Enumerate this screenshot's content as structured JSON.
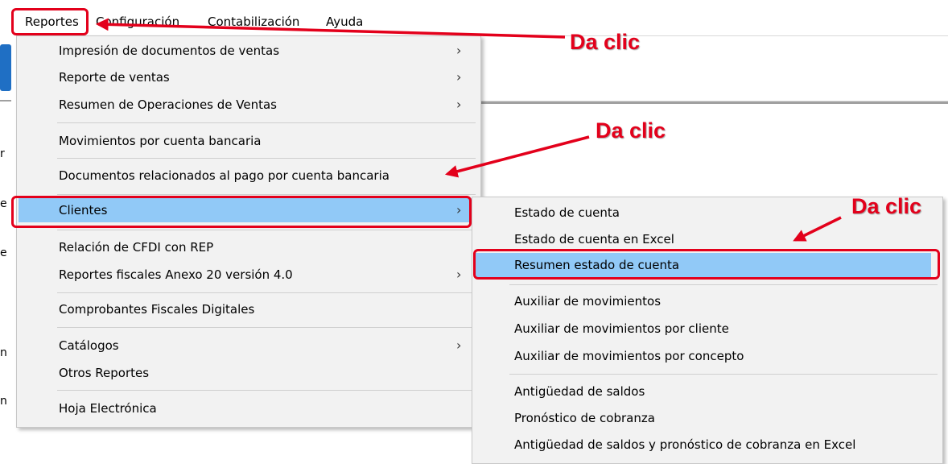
{
  "menubar": {
    "items": [
      "Reportes",
      "Configuración",
      "Contabilización",
      "Ayuda"
    ]
  },
  "left_fragments": [
    "r",
    "e",
    "e",
    "n",
    "n"
  ],
  "reportes_menu": {
    "items": [
      {
        "label": "Impresión de documentos de ventas",
        "submenu": true
      },
      {
        "label": "Reporte de ventas",
        "submenu": true
      },
      {
        "label": "Resumen de Operaciones de Ventas",
        "submenu": true
      },
      {
        "label": "Movimientos por cuenta bancaria",
        "submenu": false
      },
      {
        "label": "Documentos relacionados al pago por cuenta bancaria",
        "submenu": false
      },
      {
        "label": "Clientes",
        "submenu": true,
        "highlighted": true
      },
      {
        "label": "Relación de CFDI con REP",
        "submenu": false
      },
      {
        "label": "Reportes fiscales Anexo 20 versión 4.0",
        "submenu": true
      },
      {
        "label": "Comprobantes Fiscales Digitales",
        "submenu": false
      },
      {
        "label": "Catálogos",
        "submenu": true
      },
      {
        "label": "Otros Reportes",
        "submenu": false
      },
      {
        "label": "Hoja Electrónica",
        "submenu": false
      }
    ]
  },
  "clientes_submenu": {
    "items": [
      {
        "label": "Estado de cuenta"
      },
      {
        "label": "Estado de cuenta en Excel"
      },
      {
        "label": "Resumen estado de cuenta",
        "highlighted": true
      },
      {
        "label": "Auxiliar de movimientos"
      },
      {
        "label": "Auxiliar de movimientos por cliente"
      },
      {
        "label": "Auxiliar de movimientos por concepto"
      },
      {
        "label": "Antigüedad de saldos"
      },
      {
        "label": "Pronóstico de cobranza"
      },
      {
        "label": "Antigüedad de saldos y pronóstico de cobranza en Excel"
      }
    ]
  },
  "annotations": {
    "label_1": "Da clic",
    "label_2": "Da clic",
    "label_3": "Da clic"
  },
  "colors": {
    "highlight": "#91c9f7",
    "annotation_red": "#e3001b",
    "menu_bg": "#f2f2f2"
  },
  "icons": {
    "submenu_arrow": "chevron-right-icon"
  }
}
